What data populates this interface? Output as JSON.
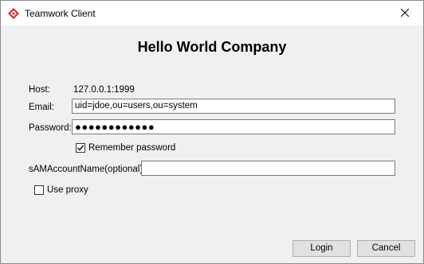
{
  "window": {
    "title": "Teamwork Client",
    "app_icon": "teamwork-diamond-icon",
    "close_icon": "close-icon"
  },
  "heading": "Hello World Company",
  "form": {
    "host_label": "Host:",
    "host_value": "127.0.0.1:1999",
    "email_label": "Email:",
    "email_value": "uid=jdoe,ou=users,ou=system",
    "password_label": "Password:",
    "password_value": "●●●●●●●●●●●●",
    "remember_label": "Remember password",
    "remember_checked": true,
    "samaccount_label": "sAMAccountName(optional):",
    "samaccount_value": "",
    "proxy_label": "Use proxy",
    "proxy_checked": false
  },
  "buttons": {
    "login": "Login",
    "cancel": "Cancel"
  },
  "colors": {
    "icon_red": "#c9302c",
    "dialog_bg": "#f0f0f0",
    "button_bg": "#e1e1e1"
  }
}
